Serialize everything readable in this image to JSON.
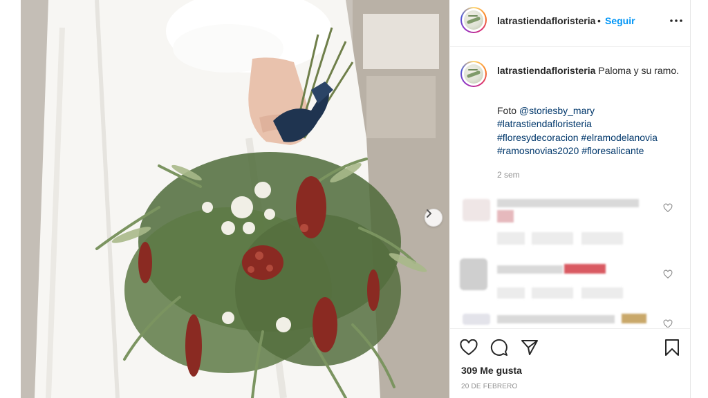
{
  "post": {
    "username": "latrastiendafloristeria",
    "separator": "•",
    "follow_label": "Seguir",
    "caption": {
      "username": "latrastiendafloristeria",
      "text": "Paloma y su ramo.",
      "credit_prefix": "Foto",
      "credit_mention": "@storiesby_mary",
      "hashtags": [
        "#latrastiendafloristeria",
        "#floresydecoracion",
        "#elramodelanovia",
        "#ramosnovias2020",
        "#floresalicante"
      ],
      "time": "2 sem"
    },
    "likes": "309 Me gusta",
    "date": "20 DE FEBRERO"
  },
  "icons": {
    "more": "more-options-icon",
    "like": "heart-icon",
    "comment": "comment-icon",
    "share": "share-icon",
    "save": "bookmark-icon",
    "next": "chevron-right-icon"
  },
  "colors": {
    "link_blue": "#0095f6",
    "mention_blue": "#00376b",
    "text": "#262626",
    "muted": "#8e8e8e"
  }
}
